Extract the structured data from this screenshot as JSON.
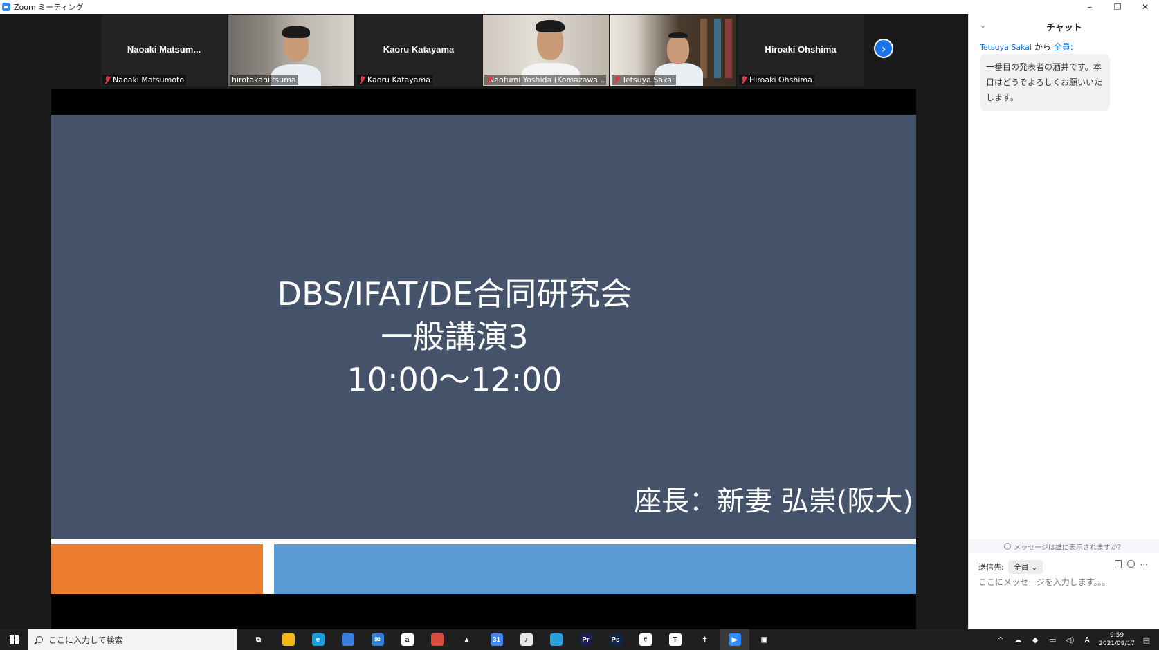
{
  "window": {
    "title": "Zoom ミーティング",
    "controls": {
      "minimize": "–",
      "restore": "❐",
      "close": "✕"
    }
  },
  "gallery": {
    "tiles": [
      {
        "big_name": "Naoaki  Matsum...",
        "label": "Naoaki Matsumoto",
        "video": false,
        "muted": true
      },
      {
        "big_name": "",
        "label": "hirotakaniitsuma",
        "video": true,
        "muted": false,
        "active_speaker": true
      },
      {
        "big_name": "Kaoru Katayama",
        "label": "Kaoru Katayama",
        "video": false,
        "muted": true
      },
      {
        "big_name": "",
        "label": "Naofumi Yoshida (Komazawa ...",
        "video": true,
        "muted": true
      },
      {
        "big_name": "",
        "label": "Tetsuya Sakai",
        "video": true,
        "muted": true
      },
      {
        "big_name": "Hiroaki Ohshima",
        "label": "Hiroaki Ohshima",
        "video": false,
        "muted": true
      }
    ],
    "next_icon": "›"
  },
  "slide": {
    "title_lines": [
      "DBS/IFAT/DE合同研究会",
      "一般講演3",
      "10:00～12:00"
    ],
    "chair": "座長：新妻 弘崇(阪大)",
    "colors": {
      "background": "#45536a",
      "orange": "#ed7d31",
      "blue": "#5b9bd5"
    }
  },
  "chat": {
    "collapse_icon": "⌄",
    "header": "チャット",
    "message": {
      "sender": "Tetsuya Sakai",
      "from_word": "から",
      "recipient": "全員:",
      "text": "一番目の発表者の酒井です。本日はどうぞよろしくお願いいたします。"
    },
    "visibility_note": "メッセージは誰に表示されますか？",
    "send_to_label": "送信先:",
    "send_to_value": "全員",
    "input_placeholder": "ここにメッセージを入力します。。。",
    "more_icon": "···"
  },
  "taskbar": {
    "search_placeholder": "ここに入力して検索",
    "apps": [
      {
        "icon": "task-view-icon",
        "glyph": "⧉",
        "color": "#1f1f1f"
      },
      {
        "icon": "file-explorer-icon",
        "glyph": "",
        "color": "#f3b71b"
      },
      {
        "icon": "edge-icon",
        "glyph": "e",
        "color": "#1a9ad6"
      },
      {
        "icon": "store-icon",
        "glyph": "",
        "color": "#3b7ddd"
      },
      {
        "icon": "mail-icon",
        "glyph": "✉",
        "color": "#2f7fd8"
      },
      {
        "icon": "amazon-icon",
        "glyph": "a",
        "color": "#ffffff"
      },
      {
        "icon": "chrome-icon",
        "glyph": "",
        "color": "#dd4b3e"
      },
      {
        "icon": "drive-icon",
        "glyph": "▲",
        "color": "#1f1f1f"
      },
      {
        "icon": "calendar-icon",
        "glyph": "31",
        "color": "#4285f4"
      },
      {
        "icon": "itunes-icon",
        "glyph": "♪",
        "color": "#e8e8e8"
      },
      {
        "icon": "app-icon",
        "glyph": "",
        "color": "#2aa0d8"
      },
      {
        "icon": "premiere-icon",
        "glyph": "Pr",
        "color": "#1b1e55"
      },
      {
        "icon": "photoshop-icon",
        "glyph": "Ps",
        "color": "#0f2746"
      },
      {
        "icon": "slack-icon",
        "glyph": "#",
        "color": "#ffffff"
      },
      {
        "icon": "typora-icon",
        "glyph": "T",
        "color": "#ffffff"
      },
      {
        "icon": "figure-icon",
        "glyph": "✝",
        "color": "#1f1f1f"
      },
      {
        "icon": "zoom-icon",
        "glyph": "▶",
        "color": "#2d8cff",
        "active": true
      },
      {
        "icon": "screen-icon",
        "glyph": "▣",
        "color": "#1f1f1f"
      }
    ],
    "tray": {
      "chevron": "^",
      "ime": "A",
      "time": "9:59",
      "date": "2021/09/17"
    }
  }
}
